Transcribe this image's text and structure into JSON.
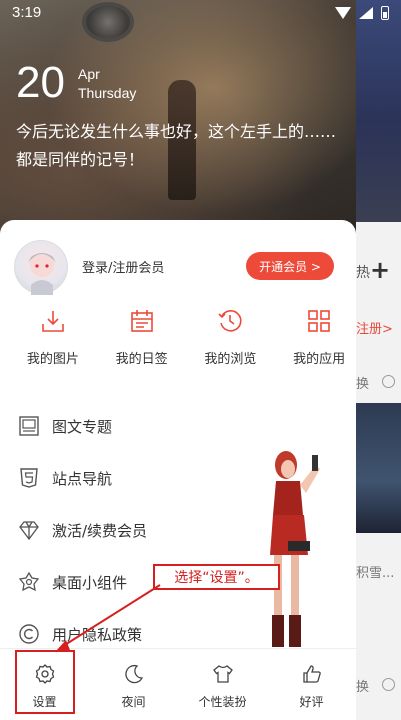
{
  "status_bar": {
    "time": "3:19"
  },
  "wallpaper": {
    "day": "20",
    "month": "Apr",
    "weekday": "Thursday",
    "quote": "今后无论发生什么事也好，这个左手上的……都是同伴的记号！"
  },
  "behind": {
    "plus": "+",
    "tab_text": "热",
    "register": "注册>",
    "item1": "换",
    "item2": "积雪...",
    "item3": "换"
  },
  "drawer": {
    "login_text": "登录/注册会员",
    "vip_button": "开通会员 >",
    "quick": [
      {
        "label": "我的图片",
        "icon": "download-icon"
      },
      {
        "label": "我的日签",
        "icon": "calendar-icon"
      },
      {
        "label": "我的浏览",
        "icon": "history-icon"
      },
      {
        "label": "我的应用",
        "icon": "grid-icon"
      }
    ],
    "menu": [
      {
        "label": "图文专题",
        "icon": "image-topic-icon"
      },
      {
        "label": "站点导航",
        "icon": "html5-icon"
      },
      {
        "label": "激活/续费会员",
        "icon": "diamond-icon"
      },
      {
        "label": "桌面小组件",
        "icon": "widget-icon"
      },
      {
        "label": "用户隐私政策",
        "icon": "copyright-icon"
      }
    ],
    "tabs": [
      {
        "label": "设置",
        "icon": "gear-icon"
      },
      {
        "label": "夜间",
        "icon": "moon-icon"
      },
      {
        "label": "个性装扮",
        "icon": "shirt-icon"
      },
      {
        "label": "好评",
        "icon": "thumbs-up-icon"
      }
    ]
  },
  "annotation": {
    "text": "选择“设置”。"
  },
  "colors": {
    "accent": "#ee4a3a",
    "annotation": "#d62020"
  }
}
